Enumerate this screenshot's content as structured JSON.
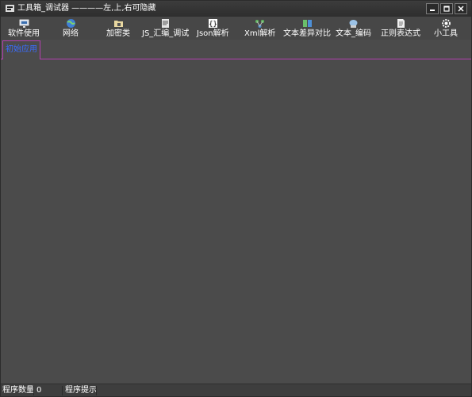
{
  "window": {
    "title": "工具箱_调试器 ————左,上,右可隐藏",
    "controls": {
      "minimize": "minimize",
      "maximize": "maximize",
      "close": "close"
    }
  },
  "toolbar": {
    "items": [
      {
        "label": "软件使用",
        "icon": "monitor-icon"
      },
      {
        "label": "网络",
        "icon": "globe-icon"
      },
      {
        "label": "加密类",
        "icon": "folder-lock-icon"
      },
      {
        "label": "JS_汇编_调试",
        "icon": "script-icon"
      },
      {
        "label": "Json解析",
        "icon": "braces-icon"
      },
      {
        "label": "Xml解析",
        "icon": "xml-tree-icon"
      },
      {
        "label": "文本差异对比",
        "icon": "compare-icon"
      },
      {
        "label": "文本_编码",
        "icon": "encode-icon"
      },
      {
        "label": "正则表达式",
        "icon": "document-icon"
      },
      {
        "label": "小工具",
        "icon": "gear-icon"
      }
    ]
  },
  "tabs": [
    {
      "label": "初始应用",
      "active": true
    }
  ],
  "statusbar": {
    "count_label": "程序数量",
    "count_value": "0",
    "hint_label": "程序提示"
  },
  "colors": {
    "background": "#4b4b4b",
    "tab_border": "#b440b0",
    "tab_text": "#3a6cff"
  }
}
